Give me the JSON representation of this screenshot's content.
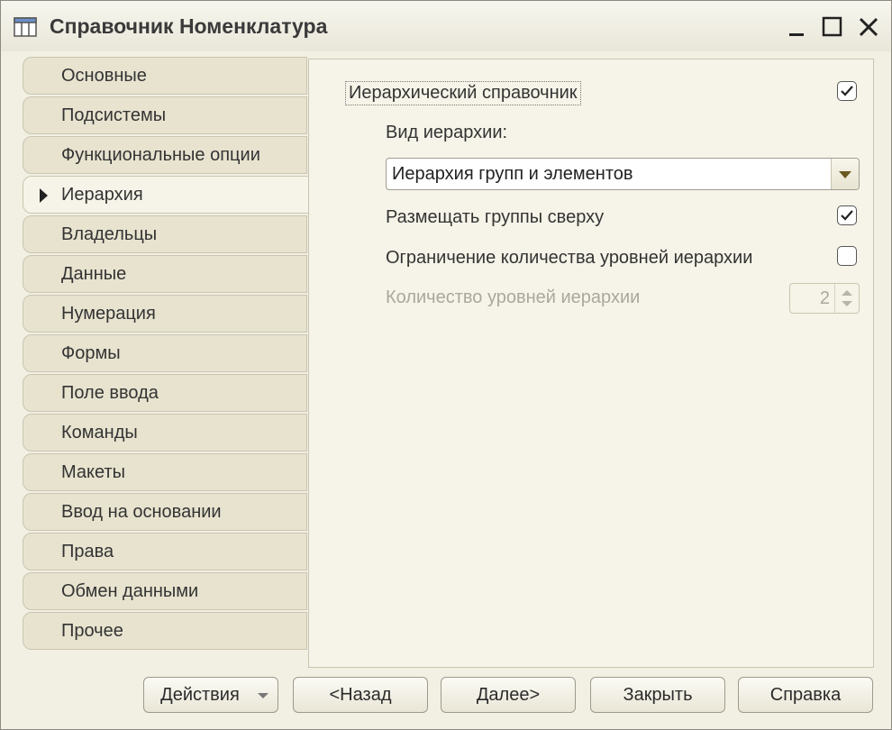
{
  "window": {
    "title": "Справочник Номенклатура",
    "icons": [
      "table-icon",
      "minimize-icon",
      "maximize-icon",
      "close-icon"
    ]
  },
  "tabs": [
    {
      "label": "Основные",
      "active": false
    },
    {
      "label": "Подсистемы",
      "active": false
    },
    {
      "label": "Функциональные опции",
      "active": false
    },
    {
      "label": "Иерархия",
      "active": true
    },
    {
      "label": "Владельцы",
      "active": false
    },
    {
      "label": "Данные",
      "active": false
    },
    {
      "label": "Нумерация",
      "active": false
    },
    {
      "label": "Формы",
      "active": false
    },
    {
      "label": "Поле ввода",
      "active": false
    },
    {
      "label": "Команды",
      "active": false
    },
    {
      "label": "Макеты",
      "active": false
    },
    {
      "label": "Ввод на основании",
      "active": false
    },
    {
      "label": "Права",
      "active": false
    },
    {
      "label": "Обмен данными",
      "active": false
    },
    {
      "label": "Прочее",
      "active": false
    }
  ],
  "panel": {
    "hierarchical": {
      "label": "Иерархический справочник",
      "checked": true
    },
    "hierarchy_type": {
      "label": "Вид иерархии:",
      "value": "Иерархия групп и элементов"
    },
    "groups_on_top": {
      "label": "Размещать группы сверху",
      "checked": true
    },
    "limit_levels": {
      "label": "Ограничение количества уровней иерархии",
      "checked": false
    },
    "level_count": {
      "label": "Количество уровней иерархии",
      "value": "2",
      "enabled": false
    }
  },
  "buttons": {
    "actions": "Действия",
    "back": "<Назад",
    "next": "Далее>",
    "close": "Закрыть",
    "help": "Справка"
  },
  "colors": {
    "background": "#f2f0e3",
    "tab": "#e7e3cf",
    "accent_arrow": "#6b5a1e"
  }
}
